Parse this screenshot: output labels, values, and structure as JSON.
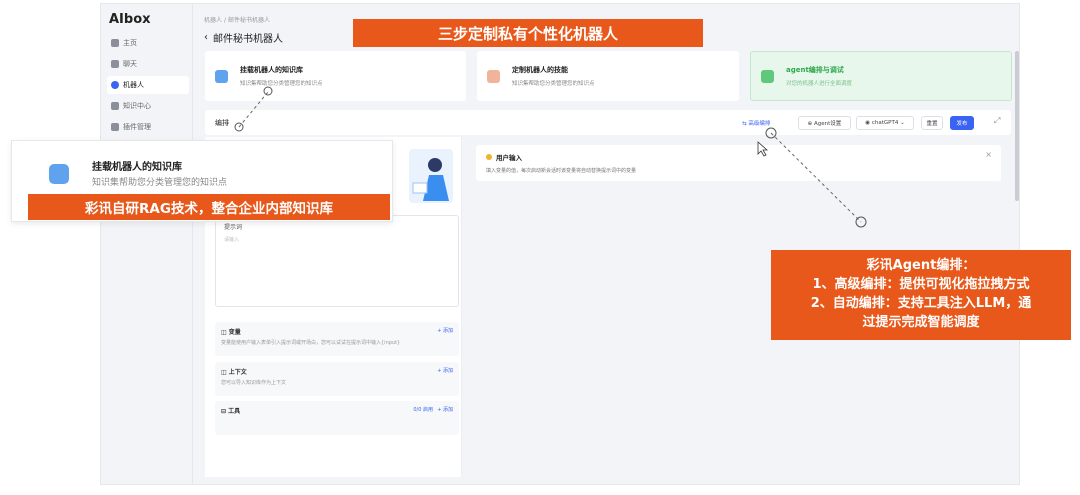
{
  "app": {
    "brand": "AIbox",
    "nav": [
      {
        "label": "主页",
        "icon": "home-icon"
      },
      {
        "label": "聊天",
        "icon": "chat-icon"
      },
      {
        "label": "机器人",
        "icon": "robot-icon",
        "active": true
      },
      {
        "label": "知识中心",
        "icon": "knowledge-icon"
      },
      {
        "label": "插件管理",
        "icon": "plugin-icon"
      }
    ]
  },
  "header": {
    "breadcrumb": [
      "机器人",
      "邮件秘书机器人"
    ],
    "title": "邮件秘书机器人"
  },
  "steps": [
    {
      "title": "挂载机器人的知识库",
      "desc": "知识集帮助您分类管理您的知识点"
    },
    {
      "title": "定制机器人的技能",
      "desc": "知识集帮助您分类管理您的知识点"
    },
    {
      "title": "agent编排与调试",
      "desc": "对您的机器人进行全面调度"
    }
  ],
  "editbar": {
    "label": "编排",
    "advanced": "⇆ 高级编排",
    "agent_settings": "⊕ Agent设置",
    "model": "◉ chatGPT4 ⌄",
    "reset": "重置",
    "publish": "发布"
  },
  "left_panel": {
    "prompt_title": "提示词",
    "prompt_placeholder": "请输入",
    "sections": [
      {
        "title": "◫ 变量",
        "desc": "变量能使用户输入表单引入提示词或开场白，您可以试试在提示词中输入{input}",
        "add": "+ 添加"
      },
      {
        "title": "◫ 上下文",
        "desc": "您可以导入知识库作为上下文",
        "add": "+ 添加"
      },
      {
        "title": "⊟ 工具",
        "desc": "",
        "add": "+ 添加",
        "extra": "0/0 启用"
      }
    ]
  },
  "right_panel": {
    "user_input_title": "用户输入",
    "user_input_desc": "填入变量的值，每次启动新会话时该变量将自动替换提示词中的变量",
    "close": "×"
  },
  "overlays": {
    "top_banner": "三步定制私有个性化机器人",
    "kb_title": "挂载机器人的知识库",
    "kb_desc": "知识集帮助您分类管理您的知识点",
    "kb_banner": "彩讯自研RAG技术，整合企业内部知识库",
    "agent_lines": [
      "彩讯Agent编排：",
      "1、高级编排：提供可视化拖拉拽方式",
      "2、自动编排：支持工具注入LLM，通",
      "过提示完成智能调度"
    ]
  },
  "colors": {
    "accent": "#3a63f3",
    "highlight": "#e8581a",
    "success": "#5ec97a"
  }
}
